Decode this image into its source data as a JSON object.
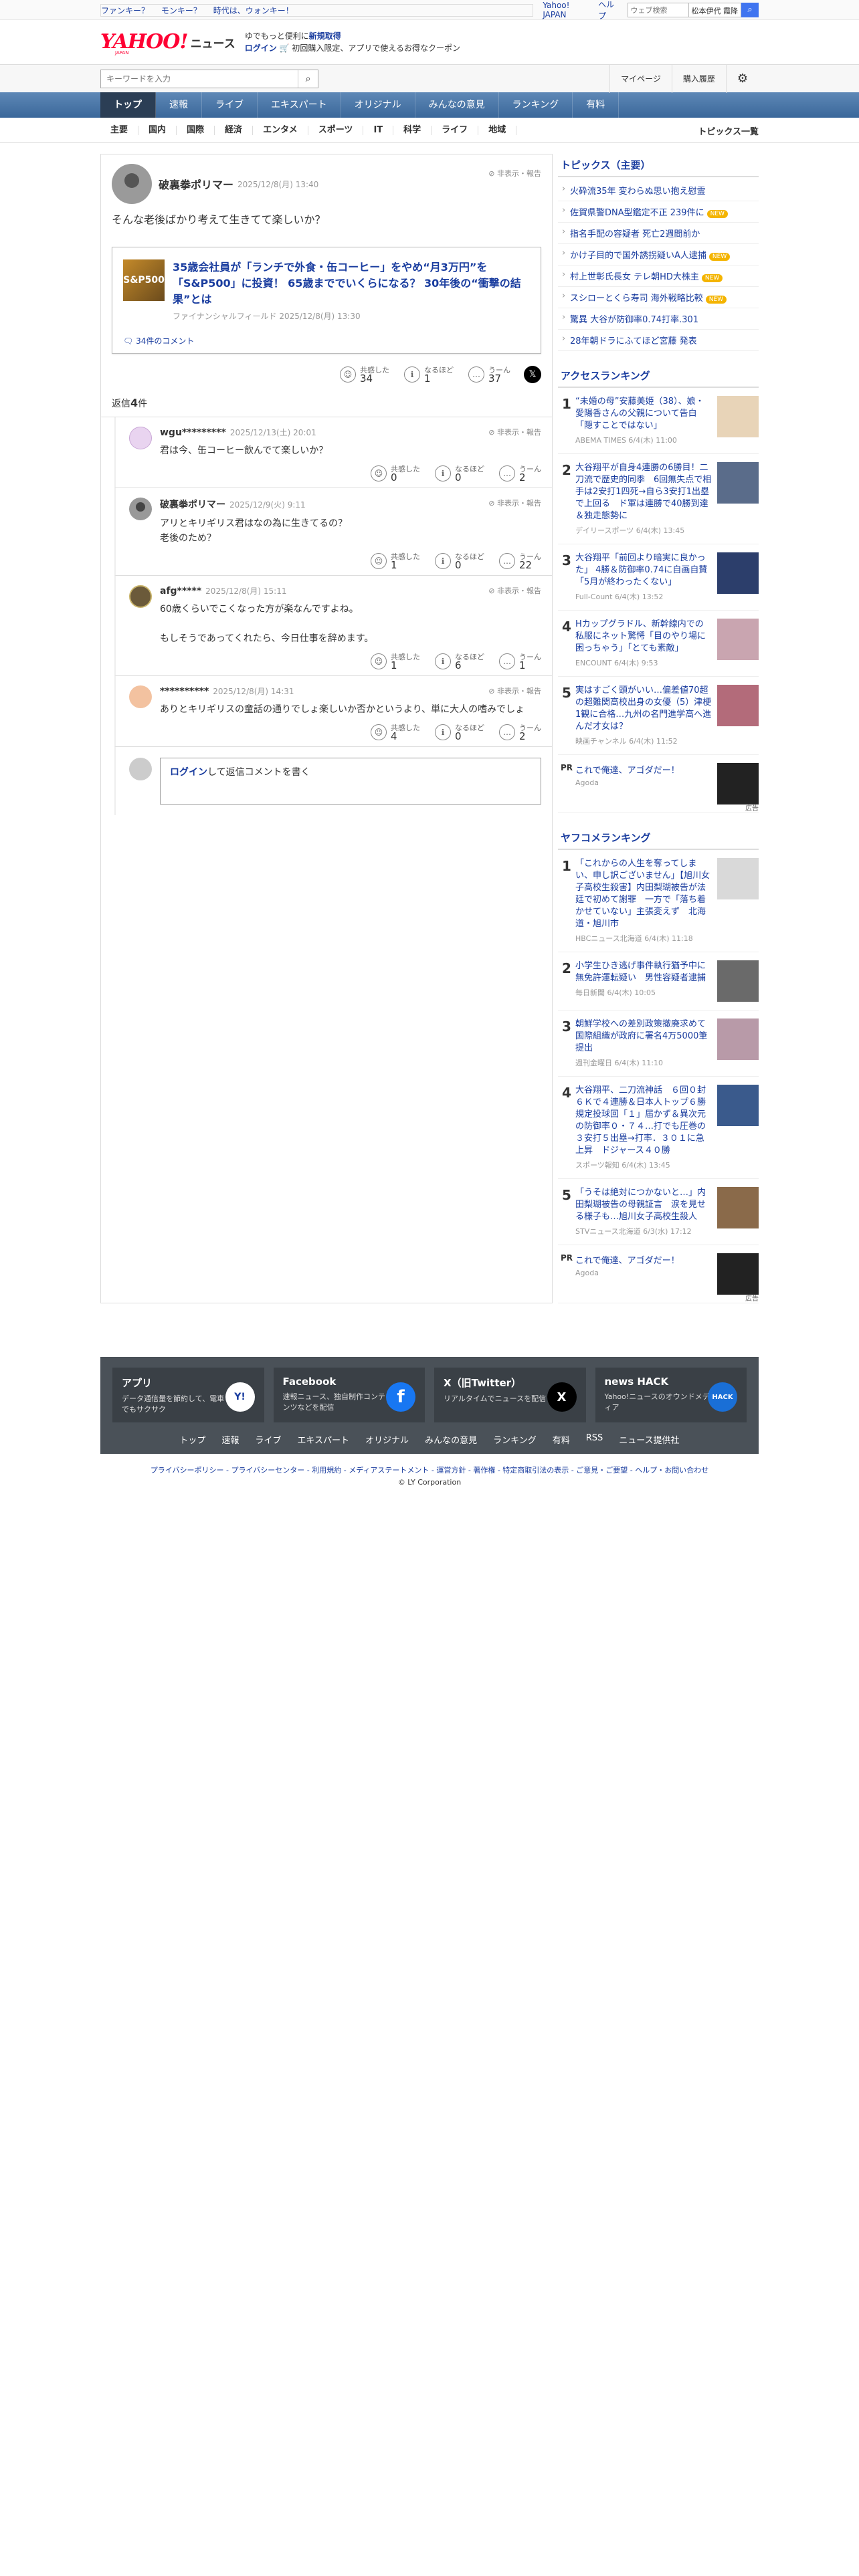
{
  "topbar": {
    "links": [
      "ファンキー？",
      "モンキー？",
      "時代は、ウォンキー！"
    ],
    "right_links": [
      "Yahoo! JAPAN",
      "ヘルプ"
    ],
    "search_placeholder": "ウェブ検索",
    "search_scope": "松本伊代 霞降"
  },
  "header": {
    "logo": "YAHOO!",
    "logo_sub": "JAPAN",
    "logo_news": "ニュース",
    "promo_line1": "ゆでもっと便利に",
    "promo_line1_b": "新規取得",
    "promo_login": "ログイン",
    "promo_line2": "初回購入限定、アプリで使えるお得なクーポン"
  },
  "search": {
    "placeholder": "キーワードを入力",
    "mypage": "マイページ",
    "history": "購入履歴"
  },
  "nav": {
    "items": [
      "トップ",
      "速報",
      "ライブ",
      "エキスパート",
      "オリジナル",
      "みんなの意見",
      "ランキング",
      "有料"
    ]
  },
  "subnav": {
    "items": [
      "主要",
      "国内",
      "国際",
      "経済",
      "エンタメ",
      "スポーツ",
      "IT",
      "科学",
      "ライフ",
      "地域"
    ],
    "right": "トピックス一覧"
  },
  "main_comment": {
    "user": "破裏拳ポリマー",
    "date": "2025/12/8(月) 13:40",
    "report": "非表示・報告",
    "body": "そんな老後ばかり考えて生きてて楽しいか？",
    "article": {
      "thumb": "S&P500",
      "title": "35歳会社員が「ランチで外食・缶コーヒー」をやめ“月3万円”を「S&P500」に投資！ 65歳まででいくらになる？ 30年後の“衝撃の結果”とは",
      "source": "ファイナンシャルフィールド 2025/12/8(月) 13:30",
      "comments": "34件のコメント"
    },
    "reactions": [
      {
        "label": "共感した",
        "count": "34"
      },
      {
        "label": "なるほど",
        "count": "1"
      },
      {
        "label": "うーん",
        "count": "37"
      }
    ]
  },
  "replies_label": "返信",
  "replies_count": "4",
  "replies_suffix": "件",
  "replies": [
    {
      "user": "wgu*********",
      "date": "2025/12/13(土) 20:01",
      "report": "非表示・報告",
      "body": "君は今、缶コーヒー飲んでて楽しいか？",
      "reactions": [
        {
          "label": "共感した",
          "count": "0"
        },
        {
          "label": "なるほど",
          "count": "0"
        },
        {
          "label": "うーん",
          "count": "2"
        }
      ]
    },
    {
      "user": "破裏拳ポリマー",
      "date": "2025/12/9(火) 9:11",
      "report": "非表示・報告",
      "body": "アリとキリギリス君はなの為に生きてるの？\n老後のため？",
      "reactions": [
        {
          "label": "共感した",
          "count": "1"
        },
        {
          "label": "なるほど",
          "count": "0"
        },
        {
          "label": "うーん",
          "count": "22"
        }
      ]
    },
    {
      "user": "afg*****",
      "date": "2025/12/8(月) 15:11",
      "report": "非表示・報告",
      "body": "60歳くらいでこくなった方が楽なんですよね。\n\nもしそうであってくれたら、今日仕事を辞めます。",
      "reactions": [
        {
          "label": "共感した",
          "count": "1"
        },
        {
          "label": "なるほど",
          "count": "6"
        },
        {
          "label": "うーん",
          "count": "1"
        }
      ]
    },
    {
      "user": "**********",
      "date": "2025/12/8(月) 14:31",
      "report": "非表示・報告",
      "body": "ありとキリギリスの童話の通りでしょ楽しいか否かというより、単に大人の嗜みでしょ",
      "reactions": [
        {
          "label": "共感した",
          "count": "4"
        },
        {
          "label": "なるほど",
          "count": "0"
        },
        {
          "label": "うーん",
          "count": "2"
        }
      ]
    }
  ],
  "compose": {
    "login": "ログイン",
    "text": "して返信コメントを書く"
  },
  "sidebar": {
    "topics_title": "トピックス（主要）",
    "topics": [
      {
        "text": "火砕流35年 変わらぬ思い抱え慰霊",
        "tag": ""
      },
      {
        "text": "佐賀県警DNA型鑑定不正 239件に",
        "tag": "NEW"
      },
      {
        "text": "指名手配の容疑者 死亡2週間前か",
        "tag": ""
      },
      {
        "text": "かけ子目的で国外誘拐疑いA人逮捕",
        "tag": "NEW"
      },
      {
        "text": "村上世彰氏長女 テレ朝HD大株主",
        "tag": "NEW"
      },
      {
        "text": "スシローとくら寿司 海外戦略比較",
        "tag": "NEW"
      },
      {
        "text": "驚異 大谷が防御率0.74打率.301",
        "tag": ""
      },
      {
        "text": "28年朝ドラにふてほど宮藤 発表",
        "tag": ""
      }
    ],
    "access_title": "アクセスランキング",
    "access": [
      {
        "n": "1",
        "t": "“未婚の母”安藤美姫（38）、娘・愛陽香さんの父親について告白「隠すことではない」",
        "m": "ABEMA TIMES 6/4(木) 11:00",
        "c": "#e8d4b8"
      },
      {
        "n": "2",
        "t": "大谷翔平が自身4連勝の6勝目！二刀流で歴史的同季　6回無失点で相手は2安打1四死→自ら3安打1出塁で上回る　ド軍は連勝で40勝到達＆独走態勢に",
        "m": "デイリースポーツ 6/4(木) 13:45",
        "c": "#5a6c8a"
      },
      {
        "n": "3",
        "t": "大谷翔平「前回より暗実に良かった」 4勝＆防御率0.74に自画自賛「5月が終わったくない」",
        "m": "Full-Count 6/4(木) 13:52",
        "c": "#2c3e6b"
      },
      {
        "n": "4",
        "t": "Hカップグラドル、新幹線内での私服にネット驚愕「目のやり場に困っちゃう」「とても素敵」",
        "m": "ENCOUNT 6/4(木) 9:53",
        "c": "#c9a5b0"
      },
      {
        "n": "5",
        "t": "実はすごく頭がいい…偏差値70超の超難関高校出身の女優（5）津梗1観に合格…九州の名門進学高へ進んだ才女は？",
        "m": "映画チャンネル 6/4(木) 11:52",
        "c": "#b36b7a"
      }
    ],
    "pr1": {
      "t": "これで俺達、アゴダだー！",
      "m": "Agoda",
      "ad": "広告"
    },
    "yafuko_title": "ヤフコメランキング",
    "yafuko": [
      {
        "n": "1",
        "t": "「これからの人生を奪ってしまい、申し訳ございません」【旭川女子高校生殺害】内田梨瑚被告が法廷で初めて謝罪　一方で「落ち着かせていない」主張変えず　北海道・旭川市",
        "m": "HBCニュース北海道 6/4(木) 11:18",
        "c": "#d9d9d9"
      },
      {
        "n": "2",
        "t": "小学生ひき逃げ事件執行猶予中に無免許運転疑い　男性容疑者逮捕",
        "m": "毎日新聞 6/4(木) 10:05",
        "c": "#6a6a6a"
      },
      {
        "n": "3",
        "t": "朝鮮学校への差別政策撤廃求めて国際組織が政府に署名4万5000筆提出",
        "m": "週刊金曜日 6/4(木) 11:10",
        "c": "#b89aa8"
      },
      {
        "n": "4",
        "t": "大谷翔平、二刀流神話　６回０封６Ｋで４連勝＆日本人トップ６勝　規定投球回「１」届かず＆異次元の防御率０・７４…打でも圧巻の３安打５出塁→打率．３０１に急上昇　ドジャース４０勝",
        "m": "スポーツ報知 6/4(木) 13:45",
        "c": "#3a5a8c"
      },
      {
        "n": "5",
        "t": "「うそは絶対につかないと…」内田梨瑚被告の母親証言　涙を見せる様子も…旭川女子高校生殺人",
        "m": "STVニュース北海道 6/3(水) 17:12",
        "c": "#8a6a4a"
      }
    ],
    "pr2": {
      "t": "これで俺達、アゴダだー！",
      "m": "Agoda",
      "ad": "広告"
    }
  },
  "footer": {
    "apps": [
      {
        "title": "アプリ",
        "desc": "データ通信量を節約して、電車でもサクサク",
        "icon": "Y!"
      },
      {
        "title": "Facebook",
        "desc": "速報ニュース、独自制作コンテンツなどを配信",
        "icon": "f"
      },
      {
        "title": "X（旧Twitter）",
        "desc": "リアルタイムでニュースを配信",
        "icon": "X"
      },
      {
        "title": "news HACK",
        "desc": "Yahoo!ニュースのオウンドメディア",
        "icon": "HACK"
      }
    ],
    "links": [
      "トップ",
      "速報",
      "ライブ",
      "エキスパート",
      "オリジナル",
      "みんなの意見",
      "ランキング",
      "有料",
      "RSS",
      "ニュース提供社"
    ],
    "bottom": "プライバシーポリシー - プライバシーセンター - 利用規約 - メディアステートメント - 運営方針 - 著作権 - 特定商取引法の表示 - ご意見・ご要望 - ヘルプ・お問い合わせ",
    "copyright": "© LY Corporation"
  }
}
